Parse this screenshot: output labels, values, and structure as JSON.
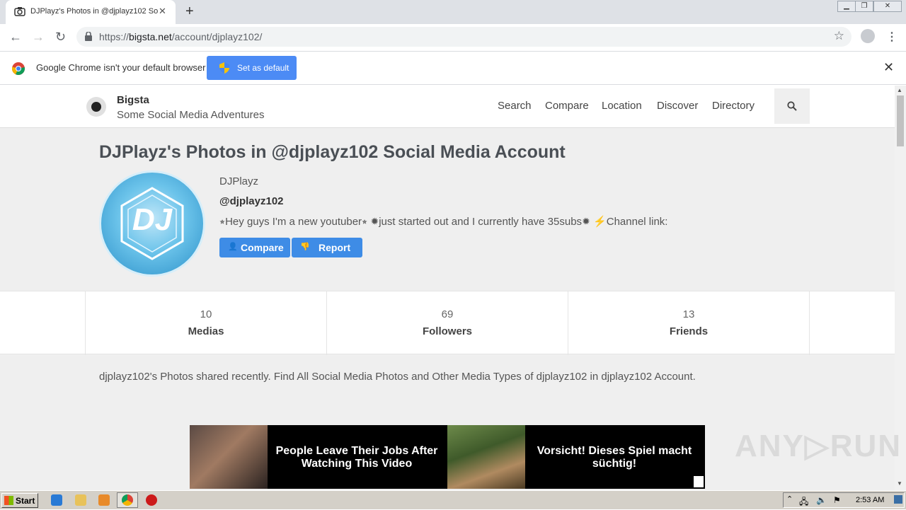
{
  "browser": {
    "tab_title": "DJPlayz's Photos in @djplayz102 Soc",
    "tab_close": "✕",
    "new_tab": "+",
    "url_prefix": "https://",
    "url_host": "bigsta.net",
    "url_path": "/account/djplayz102/",
    "infobar_text": "Google Chrome isn't your default browser",
    "infobar_button": "Set as default",
    "infobar_close": "✕"
  },
  "site": {
    "brand": "Bigsta",
    "tagline": "Some Social Media Adventures",
    "nav": [
      "Search",
      "Compare",
      "Location",
      "Discover",
      "Directory"
    ]
  },
  "profile": {
    "page_title": "DJPlayz's Photos in @djplayz102 Social Media Account",
    "avatar_text": "DJ",
    "name": "DJPlayz",
    "handle": "@djplayz102",
    "bio": "⭒Hey guys I'm a new youtuber⭒ ✹just started out and I currently have 35subs✹ ⚡Channel link:",
    "compare_label": "Compare",
    "report_label": "Report"
  },
  "stats": [
    {
      "value": "10",
      "label": "Medias"
    },
    {
      "value": "69",
      "label": "Followers"
    },
    {
      "value": "13",
      "label": "Friends"
    }
  ],
  "description": "djplayz102's Photos shared recently. Find All Social Media Photos and Other Media Types of djplayz102 in djplayz102 Account.",
  "ads": {
    "left_text": "People Leave Their Jobs After Watching This Video",
    "right_text": "Vorsicht! Dieses Spiel macht süchtig!"
  },
  "watermark": "ANY▷RUN",
  "taskbar": {
    "start_label": "Start",
    "clock": "2:53 AM"
  },
  "colors": {
    "accent_blue": "#3e8ce6",
    "chrome_blue": "#4c8bf5",
    "page_bg": "#efefef"
  }
}
